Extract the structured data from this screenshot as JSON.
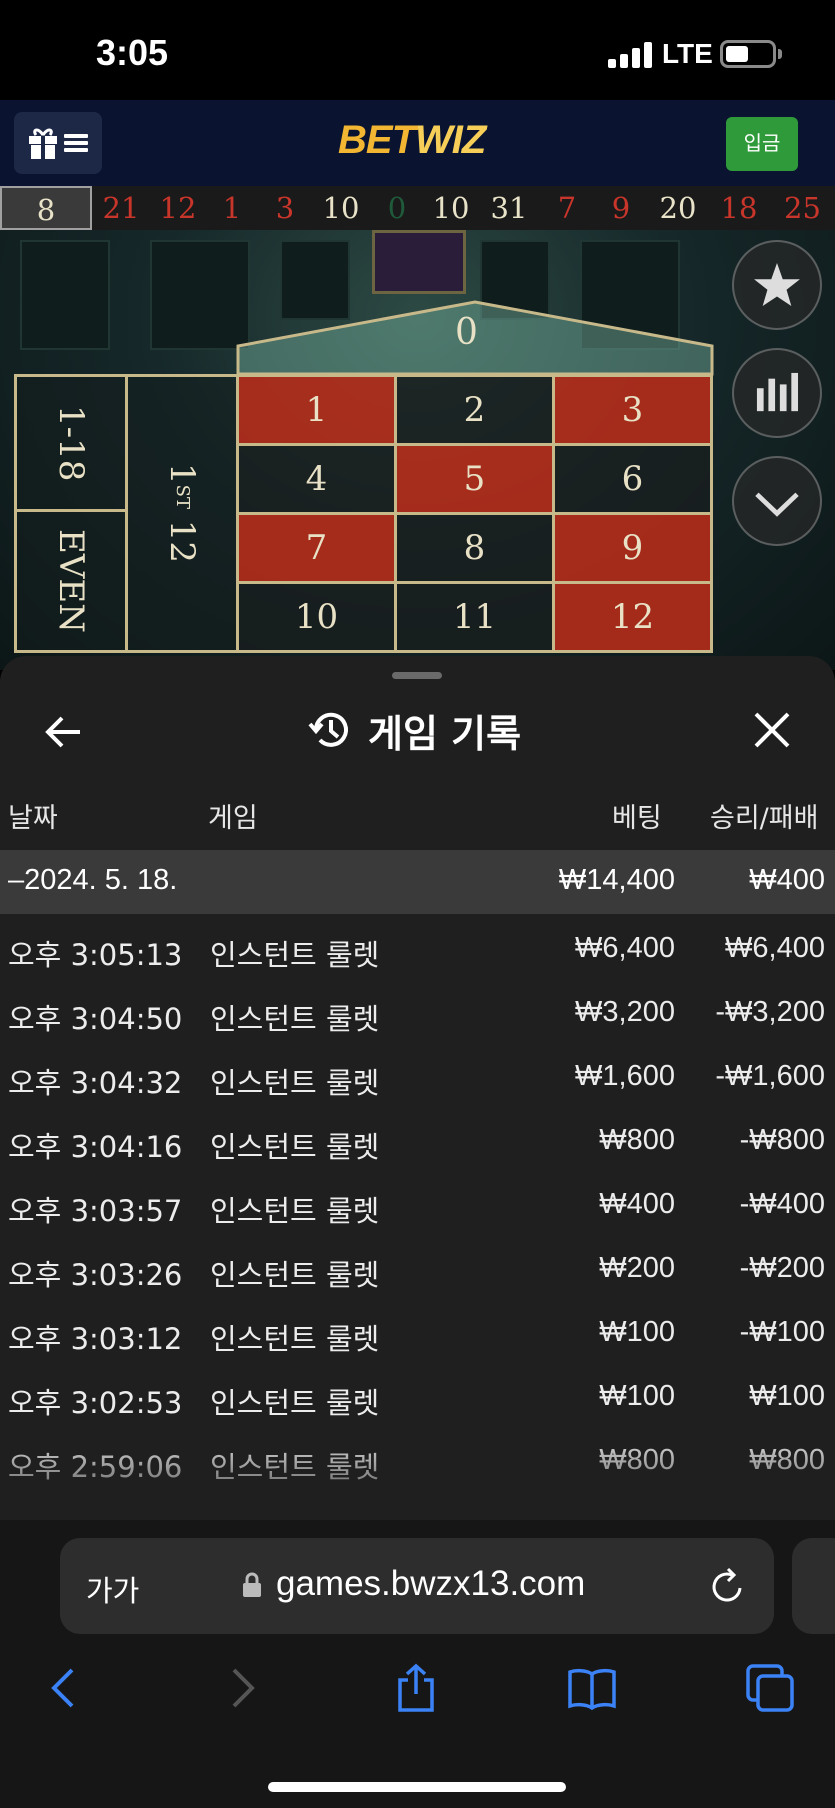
{
  "status_bar": {
    "time": "3:05",
    "network": "LTE"
  },
  "header": {
    "logo_bet": "BET",
    "logo_wiz": "WIZ",
    "deposit_label": "입금"
  },
  "recent_numbers": [
    {
      "value": "8",
      "color": "#e8e3c8"
    },
    {
      "value": "21",
      "color": "#c8352a"
    },
    {
      "value": "12",
      "color": "#c8352a"
    },
    {
      "value": "1",
      "color": "#c8352a"
    },
    {
      "value": "3",
      "color": "#c8352a"
    },
    {
      "value": "10",
      "color": "#e8e3c8"
    },
    {
      "value": "0",
      "color": "#1f5a3a"
    },
    {
      "value": "10",
      "color": "#e8e3c8"
    },
    {
      "value": "31",
      "color": "#e8e3c8"
    },
    {
      "value": "7",
      "color": "#c8352a"
    },
    {
      "value": "9",
      "color": "#c8352a"
    },
    {
      "value": "20",
      "color": "#e8e3c8"
    },
    {
      "value": "18",
      "color": "#c8352a"
    },
    {
      "value": "25",
      "color": "#c8352a"
    }
  ],
  "table": {
    "zero": "0",
    "side_low": "1-18",
    "side_even": "EVEN",
    "dozen_num": "1",
    "dozen_suffix": "ST",
    "dozen_tail": " 12",
    "numbers": [
      {
        "n": "1",
        "color": "red"
      },
      {
        "n": "2",
        "color": "black"
      },
      {
        "n": "3",
        "color": "red"
      },
      {
        "n": "4",
        "color": "black"
      },
      {
        "n": "5",
        "color": "red"
      },
      {
        "n": "6",
        "color": "black"
      },
      {
        "n": "7",
        "color": "red"
      },
      {
        "n": "8",
        "color": "black"
      },
      {
        "n": "9",
        "color": "red"
      },
      {
        "n": "10",
        "color": "black"
      },
      {
        "n": "11",
        "color": "black"
      },
      {
        "n": "12",
        "color": "red"
      }
    ]
  },
  "history": {
    "title": "게임 기록",
    "columns": {
      "date": "날짜",
      "game": "게임",
      "bet": "베팅",
      "result": "승리/패배"
    },
    "summary": {
      "date": "–2024. 5. 18.",
      "bet": "₩14,400",
      "result": "₩400"
    },
    "rows": [
      {
        "time": "오후 3:05:13",
        "game": "인스턴트 룰렛",
        "bet": "₩6,400",
        "result": "₩6,400"
      },
      {
        "time": "오후 3:04:50",
        "game": "인스턴트 룰렛",
        "bet": "₩3,200",
        "result": "-₩3,200"
      },
      {
        "time": "오후 3:04:32",
        "game": "인스턴트 룰렛",
        "bet": "₩1,600",
        "result": "-₩1,600"
      },
      {
        "time": "오후 3:04:16",
        "game": "인스턴트 룰렛",
        "bet": "₩800",
        "result": "-₩800"
      },
      {
        "time": "오후 3:03:57",
        "game": "인스턴트 룰렛",
        "bet": "₩400",
        "result": "-₩400"
      },
      {
        "time": "오후 3:03:26",
        "game": "인스턴트 룰렛",
        "bet": "₩200",
        "result": "-₩200"
      },
      {
        "time": "오후 3:03:12",
        "game": "인스턴트 룰렛",
        "bet": "₩100",
        "result": "-₩100"
      },
      {
        "time": "오후 3:02:53",
        "game": "인스턴트 룰렛",
        "bet": "₩100",
        "result": "₩100"
      },
      {
        "time": "오후 2:59:06",
        "game": "인스턴트 룰렛",
        "bet": "₩800",
        "result": "₩800"
      }
    ]
  },
  "browser": {
    "text_size_label": "가가",
    "url": "games.bwzx13.com"
  },
  "icons": {
    "status": [
      "signal-icon",
      "battery-icon"
    ],
    "header": [
      "gift-icon",
      "hamburger-icon"
    ],
    "side": [
      "star-icon",
      "stats-icon",
      "chevron-down-icon"
    ],
    "sheet": [
      "back-arrow-icon",
      "history-icon",
      "close-icon"
    ],
    "browser": [
      "lock-icon",
      "reload-icon",
      "back-icon",
      "forward-icon",
      "share-icon",
      "bookmarks-icon",
      "tabs-icon"
    ]
  }
}
